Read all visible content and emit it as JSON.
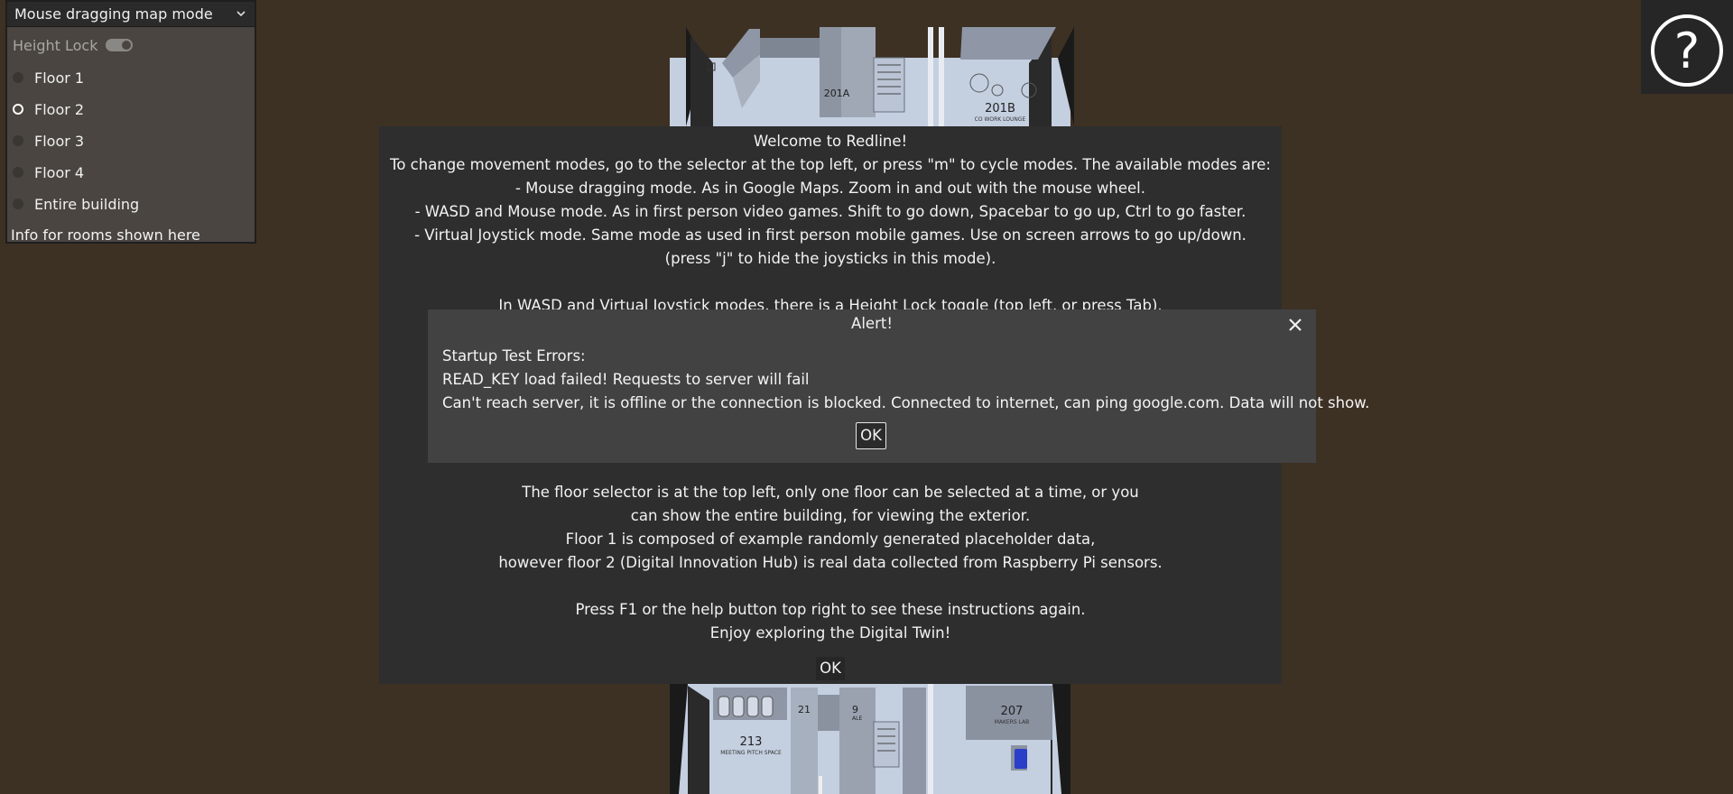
{
  "mode_selector": {
    "value": "Mouse dragging map mode",
    "icon": "chevron-down-icon"
  },
  "height_lock": {
    "label": "Height Lock",
    "on": true
  },
  "floors": [
    {
      "label": "Floor 1",
      "selected": false
    },
    {
      "label": "Floor 2",
      "selected": true
    },
    {
      "label": "Floor 3",
      "selected": false
    },
    {
      "label": "Floor 4",
      "selected": false
    },
    {
      "label": "Entire building",
      "selected": false
    }
  ],
  "info_text": "Info for rooms shown here",
  "help_button": {
    "icon": "question-circle-icon",
    "glyph": "?"
  },
  "map": {
    "rooms": [
      "201A",
      "201B",
      "213",
      "207"
    ],
    "room_captions": [
      "CO WORK LOUNGE",
      "MEETING PITCH SPACE",
      "MAKERS LAB"
    ],
    "room_stubs": [
      "21",
      "9",
      "ALE"
    ]
  },
  "welcome": {
    "lines": [
      "Welcome to Redline!",
      "To change movement modes, go to the selector at the top left, or press \"m\" to cycle modes. The available modes are:",
      "- Mouse dragging mode. As in Google Maps. Zoom in and out with the mouse wheel.",
      "- WASD and Mouse mode. As in first person video games. Shift to go down, Spacebar to go up, Ctrl to go faster.",
      "- Virtual Joystick mode. Same mode as used in first person mobile games. Use on screen arrows to go up/down.",
      "(press \"j\" to hide the joysticks in this mode).",
      "In WASD and Virtual Joystick modes, there is a Height Lock toggle (top left, or press Tab).",
      "The floor selector is at the top left, only one floor can be selected at a time, or you",
      "can show the entire building, for viewing the exterior.",
      "Floor 1 is composed of example randomly generated placeholder data,",
      "however floor 2 (Digital Innovation Hub) is real data collected from Raspberry Pi sensors.",
      "Press F1 or the help button top right to see these instructions again.",
      "Enjoy exploring the Digital Twin!"
    ],
    "ok_label": "OK"
  },
  "alert": {
    "title": "Alert!",
    "close_glyph": "×",
    "lines": [
      "Startup Test Errors:",
      "READ_KEY load failed! Requests to server will fail",
      "Can't reach server, it is offline or the connection is blocked. Connected to internet, can ping google.com. Data will not show."
    ],
    "ok_label": "OK"
  }
}
